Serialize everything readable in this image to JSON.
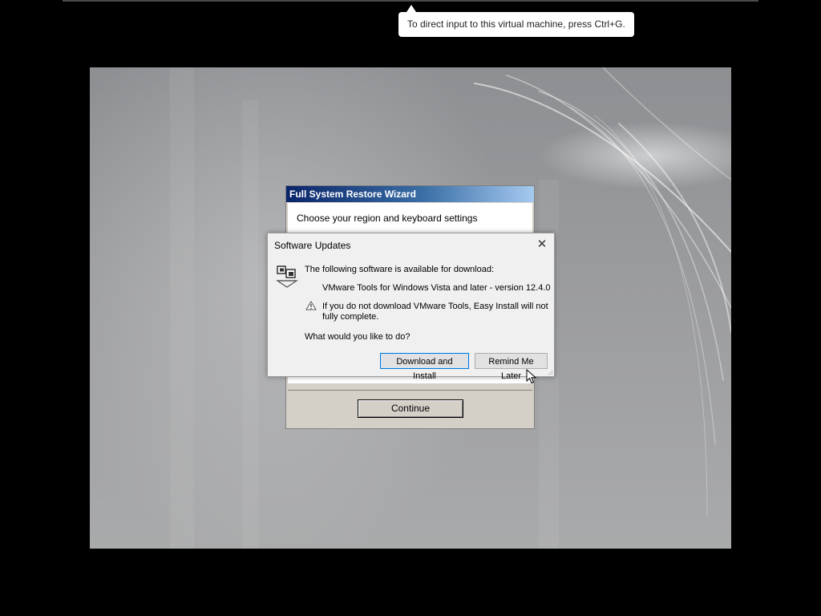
{
  "tooltip": {
    "text": "To direct input to this virtual machine, press Ctrl+G."
  },
  "wizard": {
    "title": "Full System Restore Wizard",
    "subtitle": "Choose your region and keyboard settings",
    "continue_label": "Continue"
  },
  "dialog": {
    "title": "Software Updates",
    "close_icon": "close-icon",
    "intro": "The following software is available for download:",
    "software_item": "VMware Tools for Windows Vista and later - version 12.4.0",
    "warning_line1": "If you do not download VMware Tools, Easy Install will not",
    "warning_line2": "fully complete.",
    "question": "What would you like to do?",
    "download_label": "Download and Install",
    "remind_label": "Remind Me Later"
  },
  "colors": {
    "wizard_title_start": "#0a246a",
    "wizard_title_end": "#a6caf0",
    "default_button_border": "#0078d7"
  }
}
